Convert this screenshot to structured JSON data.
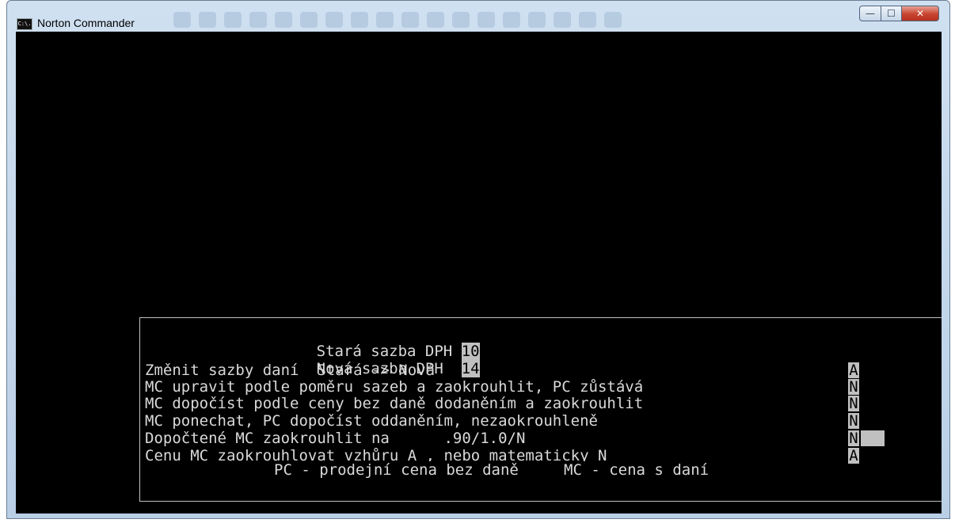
{
  "window": {
    "title": "Norton Commander",
    "icon_text": "C:\\.",
    "controls": {
      "minimize": "—",
      "maximize": "☐",
      "close": "✕"
    }
  },
  "dialog": {
    "old_rate_label": "Stará sazba DPH",
    "old_rate_value": "10",
    "new_rate_label": "Nová sazba DPH",
    "new_rate_value": "14",
    "options": [
      {
        "label": "Změnit sazby daní  Stará -> Nová",
        "value": "A"
      },
      {
        "label": "MC upravit podle poměru sazeb a zaokrouhlit, PC zůstává",
        "value": "N"
      },
      {
        "label": "MC dopočíst podle ceny bez daně dodaněním a zaokrouhlit",
        "value": "N"
      },
      {
        "label": "MC ponechat, PC dopočíst oddaněním, nezaokrouhleně",
        "value": "N"
      },
      {
        "label": "Dopočtené MC zaokrouhlit na      .90/1.0/N",
        "value": "N"
      },
      {
        "label": "Cenu MC zaokrouhlovat vzhůru A , nebo matematicky N",
        "value": "A"
      }
    ],
    "footer": "PC - prodejní cena bez daně     MC - cena s daní"
  },
  "colors": {
    "console_bg": "#000000",
    "console_fg": "#d9d9d9",
    "highlight_bg": "#c0c0c0",
    "highlight_fg": "#000000"
  }
}
